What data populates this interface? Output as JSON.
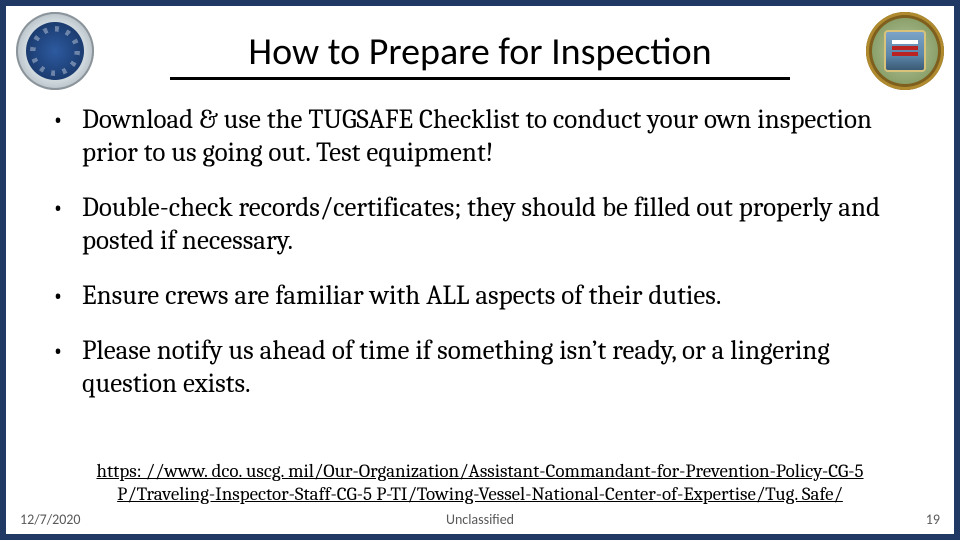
{
  "header": {
    "title": "How to Prepare for Inspection",
    "left_seal": "dhs-seal",
    "right_seal": "coast-guard-sector-seal"
  },
  "bullets": [
    "Download & use the TUGSAFE Checklist to conduct your own inspection prior to us going out. Test equipment!",
    "Double-check records/certificates; they should be filled out properly and posted if necessary.",
    "Ensure crews are familiar with ALL aspects of their duties.",
    "Please notify us ahead of time if something isn’t ready, or a lingering question exists."
  ],
  "footer": {
    "link_text": "https: //www. dco. uscg. mil/Our-Organization/Assistant-Commandant-for-Prevention-Policy-CG-5 P/Traveling-Inspector-Staff-CG-5 P-TI/Towing-Vessel-National-Center-of-Expertise/Tug. Safe/",
    "date": "12/7/2020",
    "classification": "Unclassified",
    "page_number": "19"
  }
}
